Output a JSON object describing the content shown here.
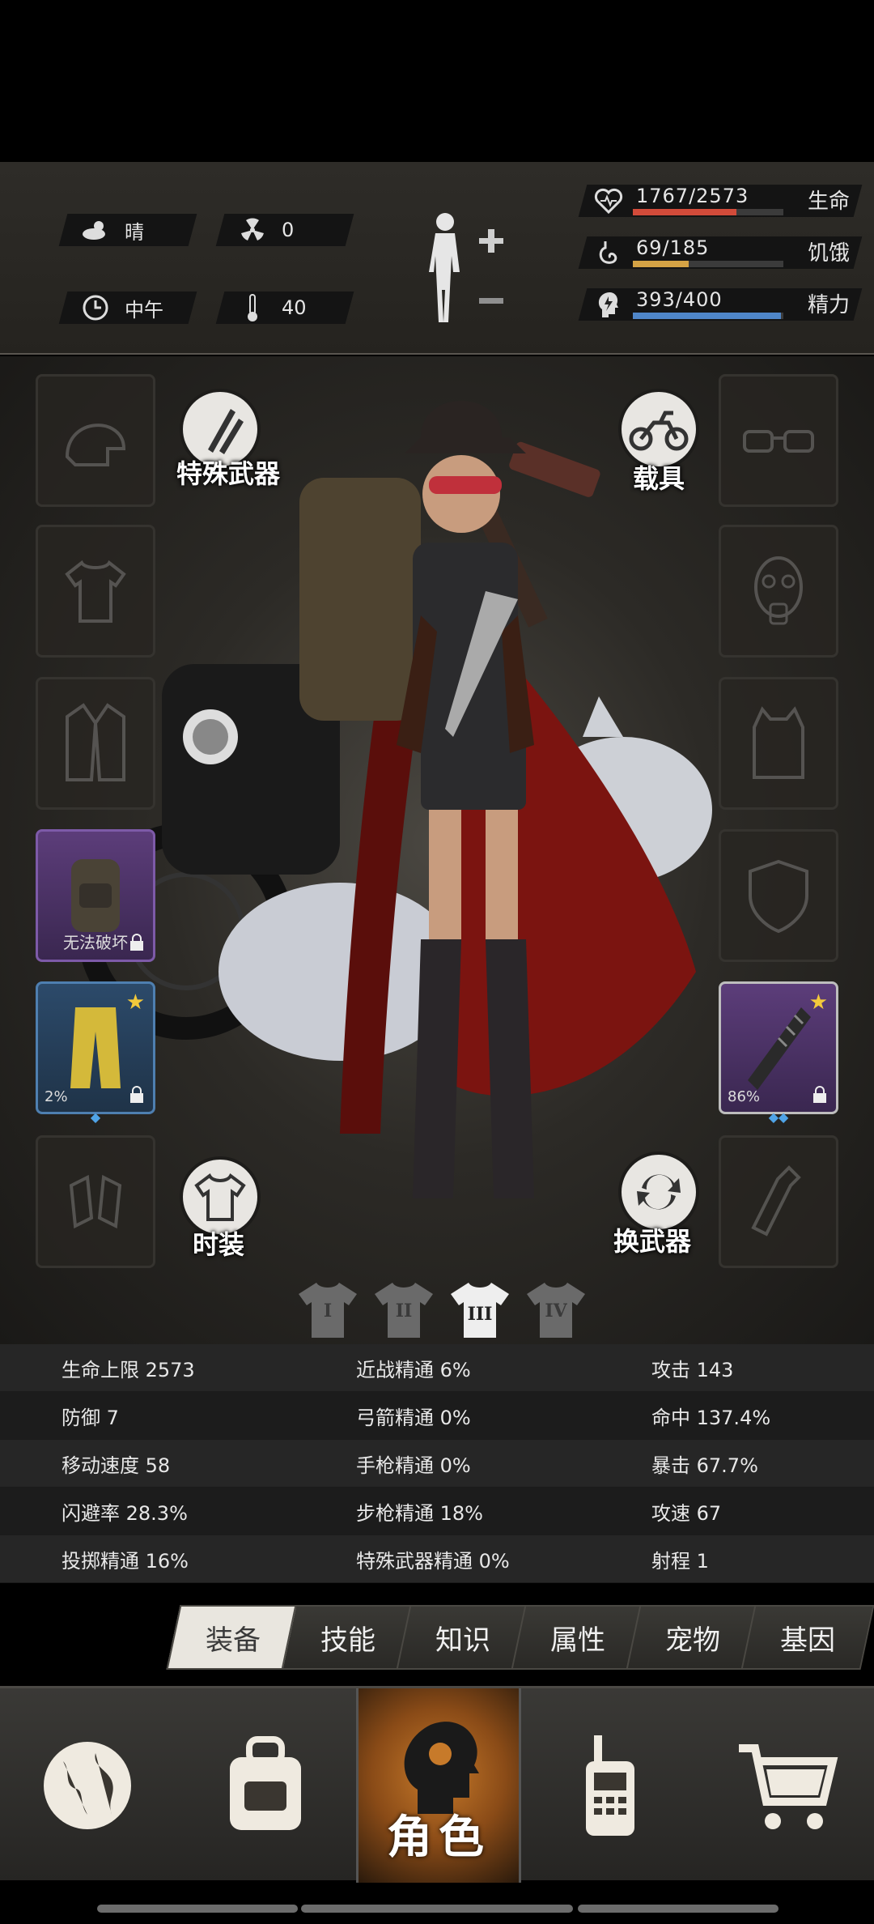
{
  "environment": {
    "weather": {
      "label": "晴",
      "icon": "cloud-sun-icon"
    },
    "radiation": {
      "value": "0",
      "icon": "radiation-icon"
    },
    "time": {
      "label": "中午",
      "icon": "clock-icon"
    },
    "temperature": {
      "value": "40",
      "icon": "thermometer-icon"
    }
  },
  "vitals": [
    {
      "label": "生命",
      "value": "1767/2573",
      "fraction": 0.687,
      "color": "#d24b3a",
      "icon": "heart-icon"
    },
    {
      "label": "饥饿",
      "value": "69/185",
      "fraction": 0.373,
      "color": "#d5a345",
      "icon": "stomach-icon"
    },
    {
      "label": "精力",
      "value": "393/400",
      "fraction": 0.983,
      "color": "#4f86c8",
      "icon": "lightning-head-icon"
    }
  ],
  "equipment": {
    "special_weapon_label": "特殊武器",
    "vehicle_label": "载具",
    "fashion_label": "时装",
    "swap_weapon_label": "换武器",
    "backpack_item_label": "无法破坏",
    "pants_item_pct": "2%",
    "weapon_item_pct": "86%"
  },
  "outfit_tabs": [
    "I",
    "II",
    "III",
    "IV"
  ],
  "outfit_active": 2,
  "stats": [
    [
      "生命上限 2573",
      "近战精通 6%",
      "攻击 143"
    ],
    [
      "防御 7",
      "弓箭精通 0%",
      "命中 137.4%"
    ],
    [
      "移动速度 58",
      "手枪精通 0%",
      "暴击 67.7%"
    ],
    [
      "闪避率 28.3%",
      "步枪精通 18%",
      "攻速 67"
    ],
    [
      "投掷精通 16%",
      "特殊武器精通 0%",
      "射程 1"
    ]
  ],
  "tabs": [
    "装备",
    "技能",
    "知识",
    "属性",
    "宠物",
    "基因"
  ],
  "active_tab": 0,
  "nav": {
    "items": [
      "globe-icon",
      "backpack-icon",
      "character-icon",
      "walkie-talkie-icon",
      "cart-icon"
    ],
    "active_label": "角色"
  }
}
